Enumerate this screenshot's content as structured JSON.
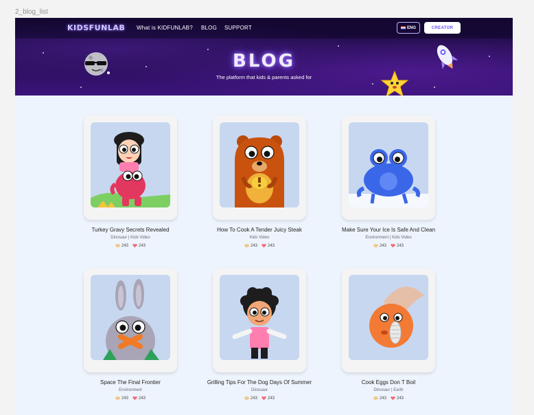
{
  "frame_label": "2_blog_list",
  "nav": {
    "logo": "KIDSFUNLAB",
    "links": [
      "What is KIDFUNLAB?",
      "BLOG",
      "SUPPORT"
    ],
    "lang": "ENG",
    "creator": "CREATOR"
  },
  "hero": {
    "title": "BLOG",
    "subtitle": "The platform that kids & parents asked for"
  },
  "cards": [
    {
      "title": "Turkey Gravy Secrets Revealed",
      "tags": "Dinosaur | Kids Video",
      "coins": "243",
      "likes": "243"
    },
    {
      "title": "How To Cook A Tender Juicy Steak",
      "tags": "Kids Video",
      "coins": "243",
      "likes": "243"
    },
    {
      "title": "Make Sure Your Ice Is Safe And Clean",
      "tags": "Environment | Kids Video",
      "coins": "243",
      "likes": "243"
    },
    {
      "title": "Space The Final Frontier",
      "tags": "Environment",
      "coins": "243",
      "likes": "243"
    },
    {
      "title": "Grilling Tips For The Dog Days Of Summer",
      "tags": "Dinosaur",
      "coins": "243",
      "likes": "243"
    },
    {
      "title": "Cook Eggs Don T Boil",
      "tags": "Dinosaur | Earth",
      "coins": "243",
      "likes": "243"
    }
  ]
}
